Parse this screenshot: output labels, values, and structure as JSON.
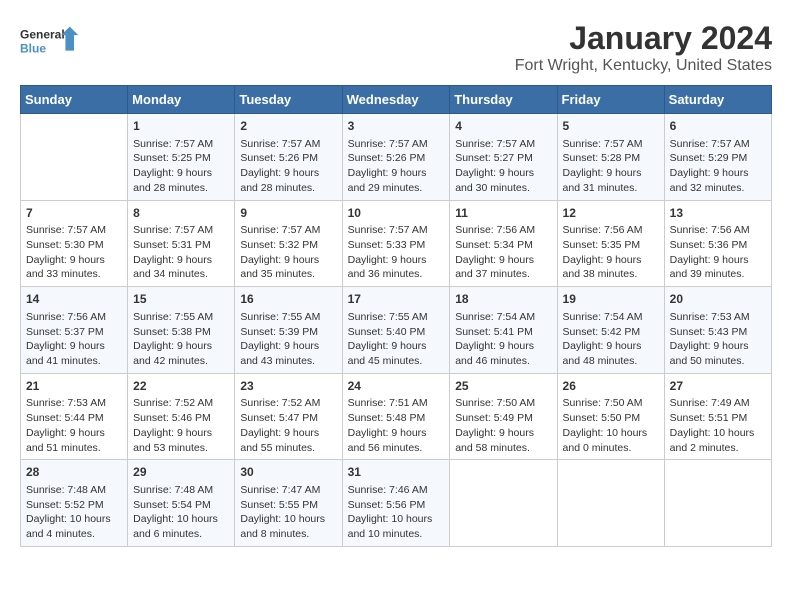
{
  "header": {
    "logo_line1": "General",
    "logo_line2": "Blue",
    "month": "January 2024",
    "location": "Fort Wright, Kentucky, United States"
  },
  "days_of_week": [
    "Sunday",
    "Monday",
    "Tuesday",
    "Wednesday",
    "Thursday",
    "Friday",
    "Saturday"
  ],
  "weeks": [
    [
      {
        "day": "",
        "sunrise": "",
        "sunset": "",
        "daylight": ""
      },
      {
        "day": "1",
        "sunrise": "Sunrise: 7:57 AM",
        "sunset": "Sunset: 5:25 PM",
        "daylight": "Daylight: 9 hours and 28 minutes."
      },
      {
        "day": "2",
        "sunrise": "Sunrise: 7:57 AM",
        "sunset": "Sunset: 5:26 PM",
        "daylight": "Daylight: 9 hours and 28 minutes."
      },
      {
        "day": "3",
        "sunrise": "Sunrise: 7:57 AM",
        "sunset": "Sunset: 5:26 PM",
        "daylight": "Daylight: 9 hours and 29 minutes."
      },
      {
        "day": "4",
        "sunrise": "Sunrise: 7:57 AM",
        "sunset": "Sunset: 5:27 PM",
        "daylight": "Daylight: 9 hours and 30 minutes."
      },
      {
        "day": "5",
        "sunrise": "Sunrise: 7:57 AM",
        "sunset": "Sunset: 5:28 PM",
        "daylight": "Daylight: 9 hours and 31 minutes."
      },
      {
        "day": "6",
        "sunrise": "Sunrise: 7:57 AM",
        "sunset": "Sunset: 5:29 PM",
        "daylight": "Daylight: 9 hours and 32 minutes."
      }
    ],
    [
      {
        "day": "7",
        "sunrise": "Sunrise: 7:57 AM",
        "sunset": "Sunset: 5:30 PM",
        "daylight": "Daylight: 9 hours and 33 minutes."
      },
      {
        "day": "8",
        "sunrise": "Sunrise: 7:57 AM",
        "sunset": "Sunset: 5:31 PM",
        "daylight": "Daylight: 9 hours and 34 minutes."
      },
      {
        "day": "9",
        "sunrise": "Sunrise: 7:57 AM",
        "sunset": "Sunset: 5:32 PM",
        "daylight": "Daylight: 9 hours and 35 minutes."
      },
      {
        "day": "10",
        "sunrise": "Sunrise: 7:57 AM",
        "sunset": "Sunset: 5:33 PM",
        "daylight": "Daylight: 9 hours and 36 minutes."
      },
      {
        "day": "11",
        "sunrise": "Sunrise: 7:56 AM",
        "sunset": "Sunset: 5:34 PM",
        "daylight": "Daylight: 9 hours and 37 minutes."
      },
      {
        "day": "12",
        "sunrise": "Sunrise: 7:56 AM",
        "sunset": "Sunset: 5:35 PM",
        "daylight": "Daylight: 9 hours and 38 minutes."
      },
      {
        "day": "13",
        "sunrise": "Sunrise: 7:56 AM",
        "sunset": "Sunset: 5:36 PM",
        "daylight": "Daylight: 9 hours and 39 minutes."
      }
    ],
    [
      {
        "day": "14",
        "sunrise": "Sunrise: 7:56 AM",
        "sunset": "Sunset: 5:37 PM",
        "daylight": "Daylight: 9 hours and 41 minutes."
      },
      {
        "day": "15",
        "sunrise": "Sunrise: 7:55 AM",
        "sunset": "Sunset: 5:38 PM",
        "daylight": "Daylight: 9 hours and 42 minutes."
      },
      {
        "day": "16",
        "sunrise": "Sunrise: 7:55 AM",
        "sunset": "Sunset: 5:39 PM",
        "daylight": "Daylight: 9 hours and 43 minutes."
      },
      {
        "day": "17",
        "sunrise": "Sunrise: 7:55 AM",
        "sunset": "Sunset: 5:40 PM",
        "daylight": "Daylight: 9 hours and 45 minutes."
      },
      {
        "day": "18",
        "sunrise": "Sunrise: 7:54 AM",
        "sunset": "Sunset: 5:41 PM",
        "daylight": "Daylight: 9 hours and 46 minutes."
      },
      {
        "day": "19",
        "sunrise": "Sunrise: 7:54 AM",
        "sunset": "Sunset: 5:42 PM",
        "daylight": "Daylight: 9 hours and 48 minutes."
      },
      {
        "day": "20",
        "sunrise": "Sunrise: 7:53 AM",
        "sunset": "Sunset: 5:43 PM",
        "daylight": "Daylight: 9 hours and 50 minutes."
      }
    ],
    [
      {
        "day": "21",
        "sunrise": "Sunrise: 7:53 AM",
        "sunset": "Sunset: 5:44 PM",
        "daylight": "Daylight: 9 hours and 51 minutes."
      },
      {
        "day": "22",
        "sunrise": "Sunrise: 7:52 AM",
        "sunset": "Sunset: 5:46 PM",
        "daylight": "Daylight: 9 hours and 53 minutes."
      },
      {
        "day": "23",
        "sunrise": "Sunrise: 7:52 AM",
        "sunset": "Sunset: 5:47 PM",
        "daylight": "Daylight: 9 hours and 55 minutes."
      },
      {
        "day": "24",
        "sunrise": "Sunrise: 7:51 AM",
        "sunset": "Sunset: 5:48 PM",
        "daylight": "Daylight: 9 hours and 56 minutes."
      },
      {
        "day": "25",
        "sunrise": "Sunrise: 7:50 AM",
        "sunset": "Sunset: 5:49 PM",
        "daylight": "Daylight: 9 hours and 58 minutes."
      },
      {
        "day": "26",
        "sunrise": "Sunrise: 7:50 AM",
        "sunset": "Sunset: 5:50 PM",
        "daylight": "Daylight: 10 hours and 0 minutes."
      },
      {
        "day": "27",
        "sunrise": "Sunrise: 7:49 AM",
        "sunset": "Sunset: 5:51 PM",
        "daylight": "Daylight: 10 hours and 2 minutes."
      }
    ],
    [
      {
        "day": "28",
        "sunrise": "Sunrise: 7:48 AM",
        "sunset": "Sunset: 5:52 PM",
        "daylight": "Daylight: 10 hours and 4 minutes."
      },
      {
        "day": "29",
        "sunrise": "Sunrise: 7:48 AM",
        "sunset": "Sunset: 5:54 PM",
        "daylight": "Daylight: 10 hours and 6 minutes."
      },
      {
        "day": "30",
        "sunrise": "Sunrise: 7:47 AM",
        "sunset": "Sunset: 5:55 PM",
        "daylight": "Daylight: 10 hours and 8 minutes."
      },
      {
        "day": "31",
        "sunrise": "Sunrise: 7:46 AM",
        "sunset": "Sunset: 5:56 PM",
        "daylight": "Daylight: 10 hours and 10 minutes."
      },
      {
        "day": "",
        "sunrise": "",
        "sunset": "",
        "daylight": ""
      },
      {
        "day": "",
        "sunrise": "",
        "sunset": "",
        "daylight": ""
      },
      {
        "day": "",
        "sunrise": "",
        "sunset": "",
        "daylight": ""
      }
    ]
  ]
}
